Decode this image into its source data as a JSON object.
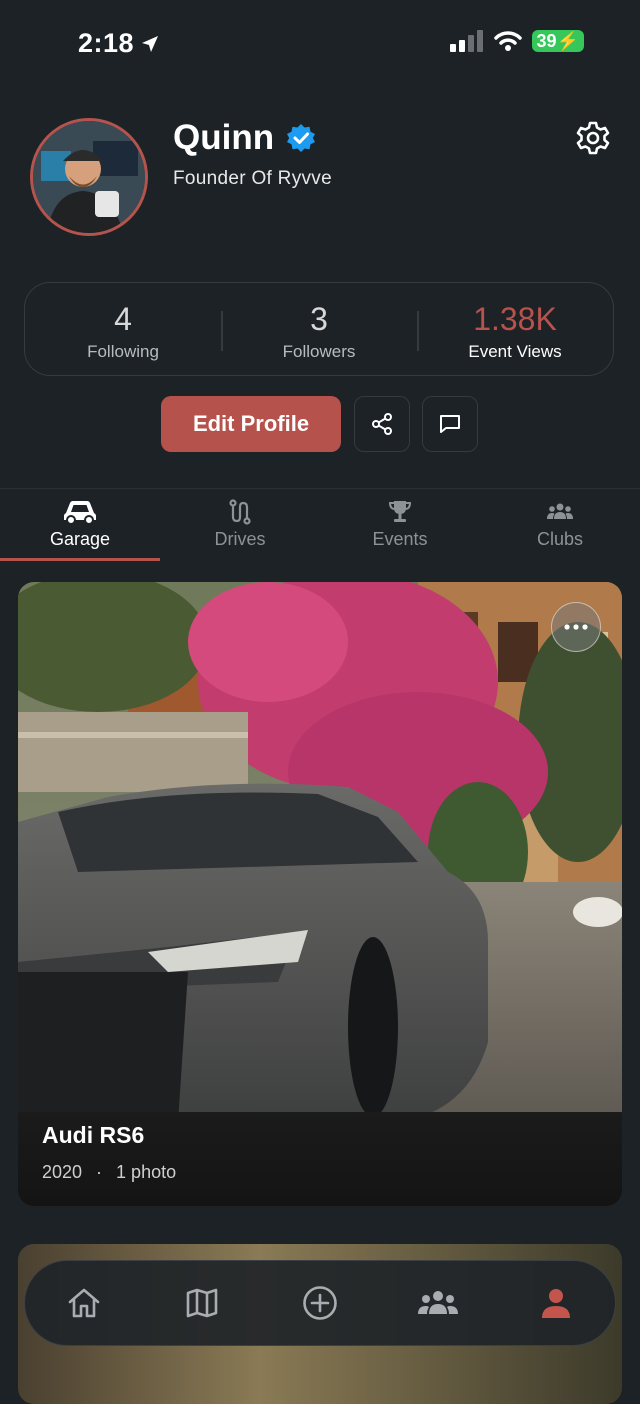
{
  "status_bar": {
    "time": "2:18",
    "battery": "39"
  },
  "profile": {
    "name": "Quinn",
    "subtitle": "Founder Of Ryvve"
  },
  "stats": [
    {
      "value": "4",
      "label": "Following"
    },
    {
      "value": "3",
      "label": "Followers"
    },
    {
      "value": "1.38K",
      "label": "Event Views"
    }
  ],
  "actions": {
    "edit_label": "Edit Profile"
  },
  "tabs": [
    {
      "label": "Garage",
      "icon": "car-icon",
      "active": true
    },
    {
      "label": "Drives",
      "icon": "route-icon",
      "active": false
    },
    {
      "label": "Events",
      "icon": "trophy-icon",
      "active": false
    },
    {
      "label": "Clubs",
      "icon": "group-icon",
      "active": false
    }
  ],
  "garage": [
    {
      "name": "Audi RS6",
      "year": "2020",
      "photos": "1 photo"
    }
  ],
  "nav": [
    "home-icon",
    "map-icon",
    "add-icon",
    "community-icon",
    "profile-icon"
  ],
  "colors": {
    "accent": "#b5524c",
    "background": "#1d2226",
    "verified": "#1d9bf0"
  }
}
